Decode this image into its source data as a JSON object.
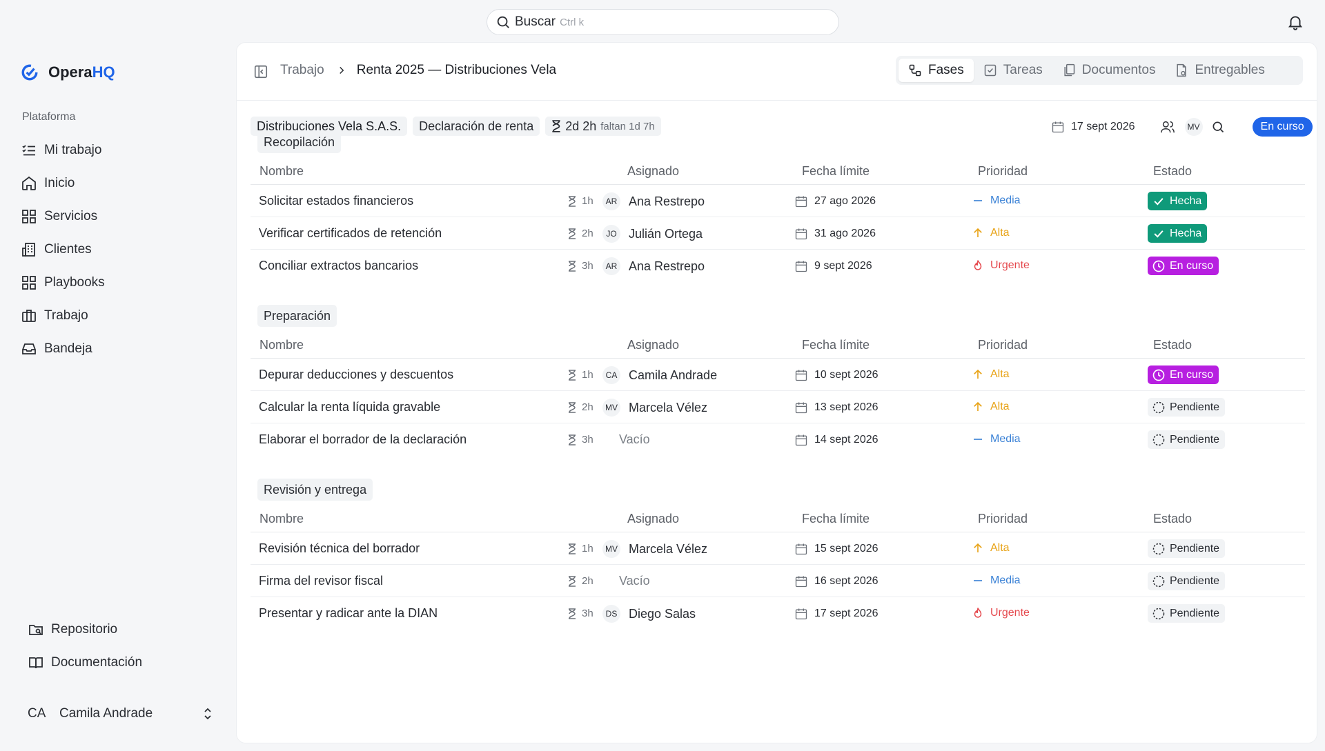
{
  "search": {
    "label": "Buscar",
    "shortcut": "Ctrl k"
  },
  "brand": {
    "name_prefix": "Opera",
    "name_suffix": "HQ",
    "accent": "#2065e8"
  },
  "sidebar": {
    "section_label": "Plataforma",
    "items": [
      {
        "label": "Mi trabajo",
        "icon": "list-check-icon"
      },
      {
        "label": "Inicio",
        "icon": "home-icon"
      },
      {
        "label": "Servicios",
        "icon": "grid-icon"
      },
      {
        "label": "Clientes",
        "icon": "building-icon"
      },
      {
        "label": "Playbooks",
        "icon": "grid-icon"
      },
      {
        "label": "Trabajo",
        "icon": "briefcase-icon"
      },
      {
        "label": "Bandeja",
        "icon": "inbox-icon"
      }
    ],
    "bottom_items": [
      {
        "label": "Repositorio",
        "icon": "folder-search-icon"
      },
      {
        "label": "Documentación",
        "icon": "book-icon"
      }
    ],
    "user": {
      "initials": "CA",
      "name": "Camila Andrade"
    }
  },
  "breadcrumb": {
    "parent": "Trabajo",
    "current": "Renta 2025 — Distribuciones Vela"
  },
  "tabs": [
    {
      "label": "Fases",
      "active": true,
      "icon": "phases-icon"
    },
    {
      "label": "Tareas",
      "active": false,
      "icon": "checkbox-icon"
    },
    {
      "label": "Documentos",
      "active": false,
      "icon": "documents-icon"
    },
    {
      "label": "Entregables",
      "active": false,
      "icon": "file-deliverable-icon"
    }
  ],
  "meta": {
    "client": "Distribuciones Vela S.A.S.",
    "service": "Declaración de renta",
    "duration": "2d 2h",
    "remaining": "faltan 1d 7h",
    "due_date": "17 sept 2026",
    "assignee_initials": "MV",
    "status": "En curso"
  },
  "columns": {
    "name": "Nombre",
    "assignee": "Asignado",
    "due": "Fecha límite",
    "priority": "Prioridad",
    "status": "Estado"
  },
  "phases": [
    {
      "title": "Recopilación",
      "tasks": [
        {
          "name": "Solicitar estados financieros",
          "duration": "1h",
          "initials": "AR",
          "assignee": "Ana Restrepo",
          "due": "27 ago 2026",
          "priority": "Media",
          "status": "Hecha"
        },
        {
          "name": "Verificar certificados de retención",
          "duration": "2h",
          "initials": "JO",
          "assignee": "Julián Ortega",
          "due": "31 ago 2026",
          "priority": "Alta",
          "status": "Hecha"
        },
        {
          "name": "Conciliar extractos bancarios",
          "duration": "3h",
          "initials": "AR",
          "assignee": "Ana Restrepo",
          "due": "9 sept 2026",
          "priority": "Urgente",
          "status": "En curso"
        }
      ]
    },
    {
      "title": "Preparación",
      "tasks": [
        {
          "name": "Depurar deducciones y descuentos",
          "duration": "1h",
          "initials": "CA",
          "assignee": "Camila Andrade",
          "due": "10 sept 2026",
          "priority": "Alta",
          "status": "En curso"
        },
        {
          "name": "Calcular la renta líquida gravable",
          "duration": "2h",
          "initials": "MV",
          "assignee": "Marcela Vélez",
          "due": "13 sept 2026",
          "priority": "Alta",
          "status": "Pendiente"
        },
        {
          "name": "Elaborar el borrador de la declaración",
          "duration": "3h",
          "initials": "",
          "assignee": "Vacío",
          "due": "14 sept 2026",
          "priority": "Media",
          "status": "Pendiente"
        }
      ]
    },
    {
      "title": "Revisión y entrega",
      "tasks": [
        {
          "name": "Revisión técnica del borrador",
          "duration": "1h",
          "initials": "MV",
          "assignee": "Marcela Vélez",
          "due": "15 sept 2026",
          "priority": "Alta",
          "status": "Pendiente"
        },
        {
          "name": "Firma del revisor fiscal",
          "duration": "2h",
          "initials": "",
          "assignee": "Vacío",
          "due": "16 sept 2026",
          "priority": "Media",
          "status": "Pendiente"
        },
        {
          "name": "Presentar y radicar ante la DIAN",
          "duration": "3h",
          "initials": "DS",
          "assignee": "Diego Salas",
          "due": "17 sept 2026",
          "priority": "Urgente",
          "status": "Pendiente"
        }
      ]
    }
  ],
  "colors": {
    "priority_media": "#3b82d6",
    "priority_alta": "#e8a317",
    "priority_urgente": "#e5484d",
    "status_hecha_bg": "#0f9a7a",
    "status_en_curso_bg": "#b71fe0",
    "status_pendiente_bg": "#f1f3f5",
    "status_pill_bg": "#2065e8"
  }
}
